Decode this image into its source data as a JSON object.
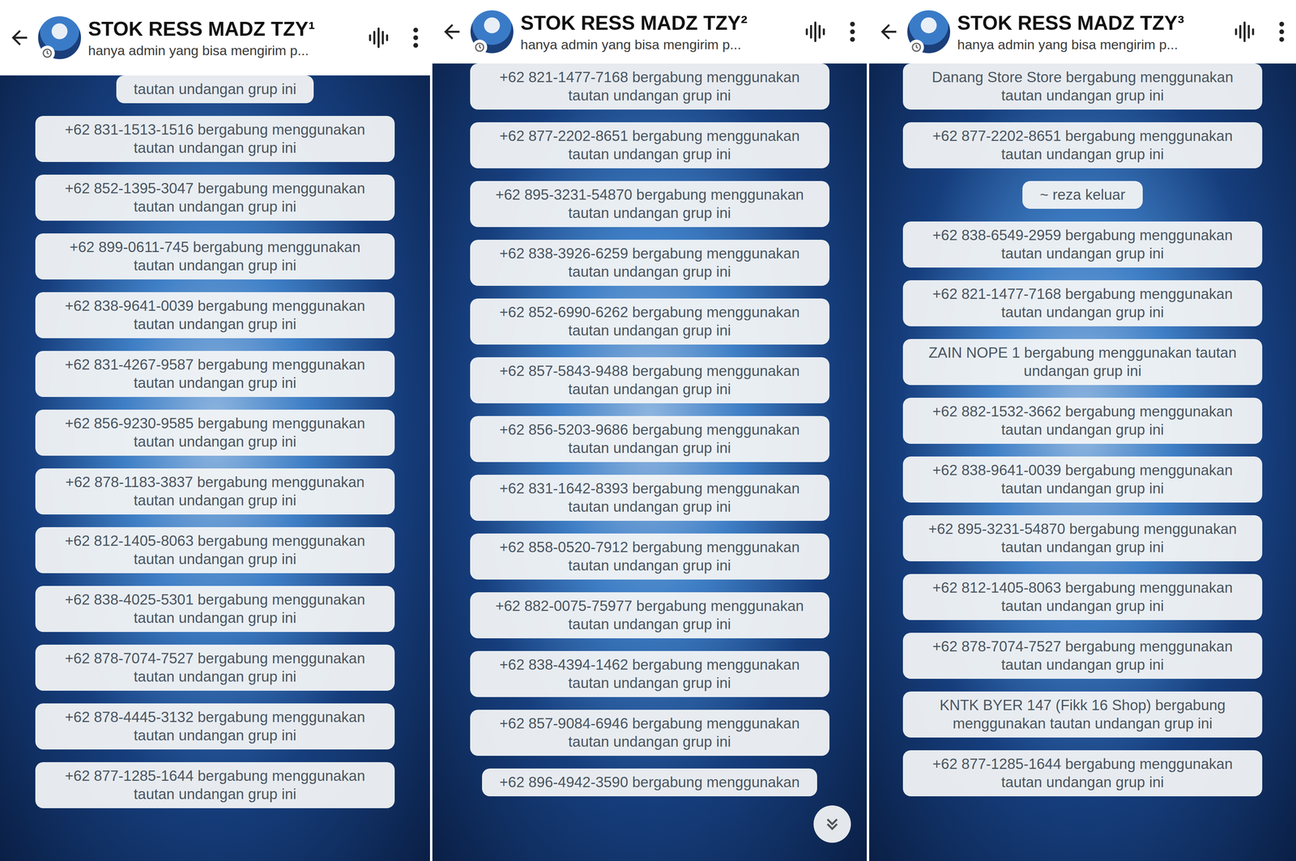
{
  "panels": [
    {
      "title": "STOK RESS MADZ TZY¹",
      "subtitle": "hanya admin yang bisa mengirim p...",
      "show_scroll_button": false,
      "messages": [
        "tautan undangan grup ini",
        "+62 831-1513-1516 bergabung menggunakan tautan undangan grup ini",
        "+62 852-1395-3047 bergabung menggunakan tautan undangan grup ini",
        "+62 899-0611-745 bergabung menggunakan tautan undangan grup ini",
        "+62 838-9641-0039 bergabung menggunakan tautan undangan grup ini",
        "+62 831-4267-9587 bergabung menggunakan tautan undangan grup ini",
        "+62 856-9230-9585 bergabung menggunakan tautan undangan grup ini",
        "+62 878-1183-3837 bergabung menggunakan tautan undangan grup ini",
        "+62 812-1405-8063 bergabung menggunakan tautan undangan grup ini",
        "+62 838-4025-5301 bergabung menggunakan tautan undangan grup ini",
        "+62 878-7074-7527 bergabung menggunakan tautan undangan grup ini",
        "+62 878-4445-3132 bergabung menggunakan tautan undangan grup ini",
        "+62 877-1285-1644 bergabung menggunakan tautan undangan grup ini"
      ]
    },
    {
      "title": "STOK RESS MADZ TZY²",
      "subtitle": "hanya admin yang bisa mengirim p...",
      "show_scroll_button": true,
      "messages": [
        "+62 821-1477-7168 bergabung menggunakan tautan undangan grup ini",
        "+62 877-2202-8651 bergabung menggunakan tautan undangan grup ini",
        "+62 895-3231-54870 bergabung menggunakan tautan undangan grup ini",
        "+62 838-3926-6259 bergabung menggunakan tautan undangan grup ini",
        "+62 852-6990-6262 bergabung menggunakan tautan undangan grup ini",
        "+62 857-5843-9488 bergabung menggunakan tautan undangan grup ini",
        "+62 856-5203-9686 bergabung menggunakan tautan undangan grup ini",
        "+62 831-1642-8393 bergabung menggunakan tautan undangan grup ini",
        "+62 858-0520-7912 bergabung menggunakan tautan undangan grup ini",
        "+62 882-0075-75977 bergabung menggunakan tautan undangan grup ini",
        "+62 838-4394-1462 bergabung menggunakan tautan undangan grup ini",
        "+62 857-9084-6946 bergabung menggunakan tautan undangan grup ini",
        "+62 896-4942-3590 bergabung menggunakan"
      ]
    },
    {
      "title": "STOK RESS MADZ TZY³",
      "subtitle": "hanya admin yang bisa mengirim p...",
      "show_scroll_button": false,
      "messages": [
        "Danang Store Store bergabung menggunakan tautan undangan grup ini",
        "+62 877-2202-8651 bergabung menggunakan tautan undangan grup ini",
        "~ reza keluar",
        "+62 838-6549-2959 bergabung menggunakan tautan undangan grup ini",
        "+62 821-1477-7168 bergabung menggunakan tautan undangan grup ini",
        "ZAIN NOPE 1 bergabung menggunakan tautan undangan grup ini",
        "+62 882-1532-3662 bergabung menggunakan tautan undangan grup ini",
        "+62 838-9641-0039 bergabung menggunakan tautan undangan grup ini",
        "+62 895-3231-54870 bergabung menggunakan tautan undangan grup ini",
        "+62 812-1405-8063 bergabung menggunakan tautan undangan grup ini",
        "+62 878-7074-7527 bergabung menggunakan tautan undangan grup ini",
        "KNTK BYER 147 (Fikk 16 Shop) bergabung menggunakan tautan undangan grup ini",
        "+62 877-1285-1644 bergabung menggunakan tautan undangan grup ini"
      ]
    }
  ]
}
